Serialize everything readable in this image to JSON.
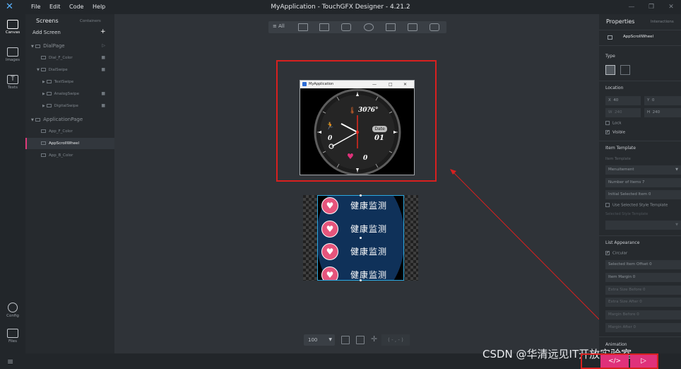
{
  "window": {
    "title": "MyApplication - TouchGFX Designer - 4.21.2",
    "menu": [
      "File",
      "Edit",
      "Code",
      "Help"
    ]
  },
  "rail": {
    "canvas": "Canvas",
    "images": "Images",
    "texts": "Texts",
    "config": "Config",
    "files": "Files"
  },
  "screens": {
    "tab_screens": "Screens",
    "tab_containers": "Containers",
    "add_screen": "Add Screen",
    "items": [
      {
        "label": "DialPage"
      },
      {
        "label": "Dial_F_Color"
      },
      {
        "label": "DialSwipe"
      },
      {
        "label": "TextSwipe"
      },
      {
        "label": "AnalogSwipe"
      },
      {
        "label": "DigitalSwipe"
      },
      {
        "label": "ApplicationPage"
      },
      {
        "label": "App_F_Color"
      },
      {
        "label": "AppScrollWheel"
      },
      {
        "label": "App_B_Color"
      }
    ]
  },
  "canvas": {
    "toolbar_all": "≡ All",
    "zoom": "100",
    "coords": "( - , - )"
  },
  "simulator": {
    "title": "MyApplication",
    "temp": "30?6°",
    "date_label": "Date",
    "date_value": "01",
    "steps": "0",
    "heart": "0"
  },
  "scroll_wheel": {
    "items": [
      "健康监测",
      "健康监测",
      "健康监测",
      "健康监测"
    ]
  },
  "properties": {
    "tab_properties": "Properties",
    "tab_interactions": "Interactions",
    "widget_name": "AppScrollWheel",
    "type_heading": "Type",
    "location_heading": "Location",
    "x_label": "X",
    "x_value": "40",
    "y_label": "Y",
    "y_value": "0",
    "w_label": "W",
    "w_value": "240",
    "h_label": "H",
    "h_value": "240",
    "lock": "Lock",
    "visible": "Visible",
    "item_template_heading": "Item Template",
    "item_template_label": "Item Template",
    "item_template_value": "Menuitement",
    "number_of_items": "Number of Items  7",
    "initial_selected_item": "Initial Selected Item  0",
    "use_selected_style": "Use Selected Style Template",
    "selected_style_template": "Selected Style Template",
    "list_appearance_heading": "List Appearance",
    "circular": "Circular",
    "selected_item_offset": "Selected Item Offset  0",
    "item_margin": "Item Margin  0",
    "extra_size_before": "Extra Size Before  0",
    "extra_size_after": "Extra Size After  0",
    "margin_before": "Margin Before  0",
    "margin_after": "Margin After  0",
    "animation_heading": "Animation"
  },
  "watermark": "CSDN @华清远见IT开放实验室"
}
